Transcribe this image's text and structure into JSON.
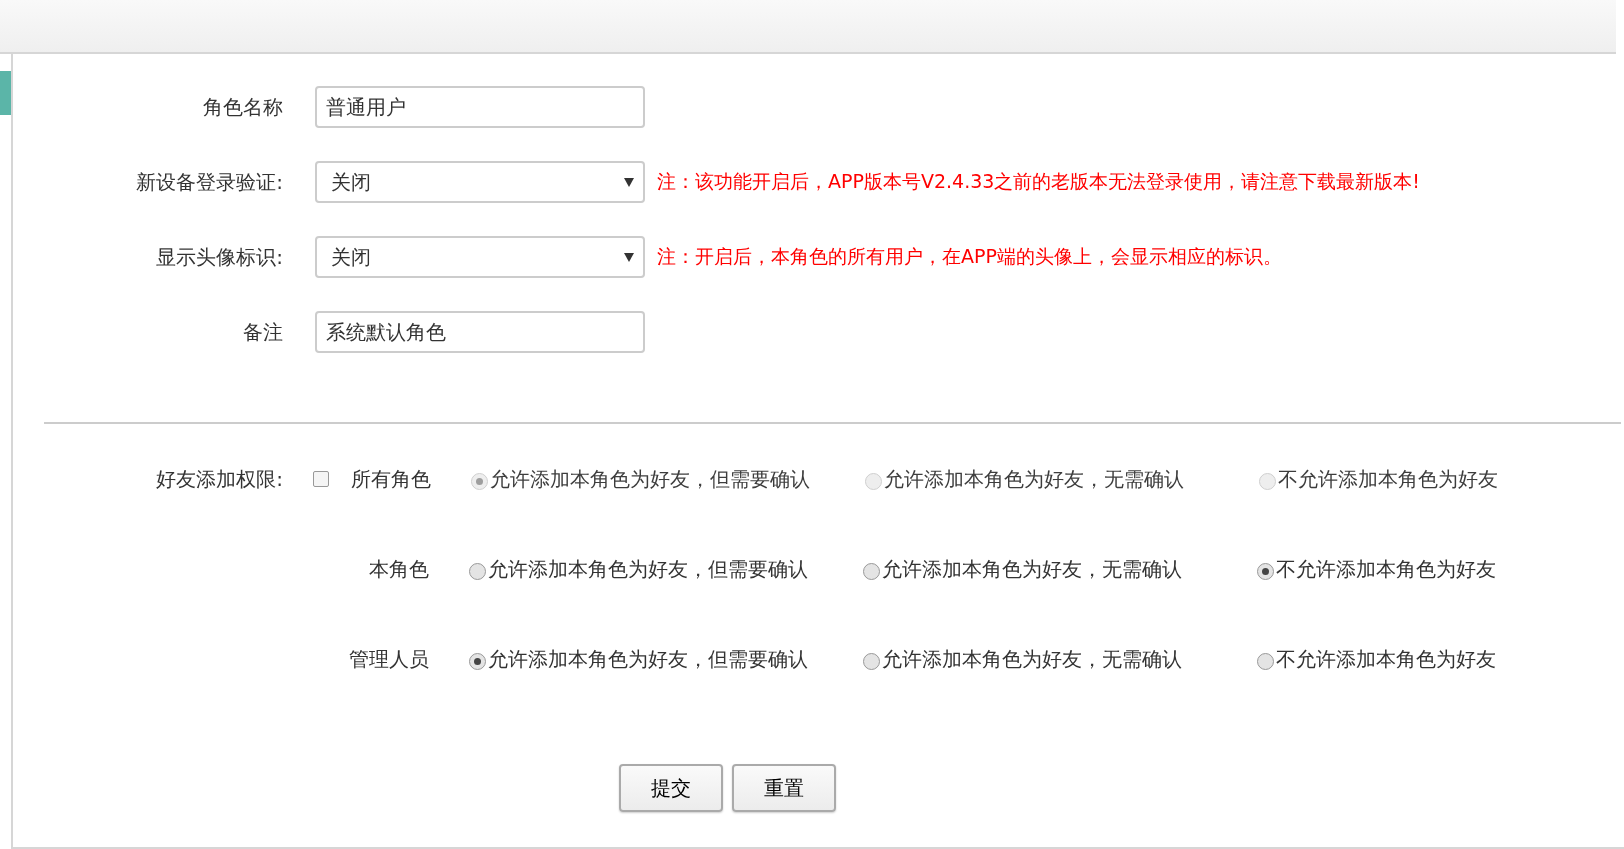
{
  "fields": [
    {
      "kind": "text",
      "label": "角色名称",
      "value": "普通用户"
    },
    {
      "kind": "select",
      "label": "新设备登录验证:",
      "value": "关闭",
      "note": "注：该功能开启后，APP版本号V2.4.33之前的老版本无法登录使用，请注意下载最新版本!"
    },
    {
      "kind": "select",
      "label": "显示头像标识:",
      "value": "关闭",
      "note": "注：开启后，本角色的所有用户，在APP端的头像上，会显示相应的标识。"
    },
    {
      "kind": "text",
      "label": "备注",
      "value": "系统默认角色"
    }
  ],
  "friend_permission": {
    "label": "好友添加权限:",
    "groups": [
      {
        "kind": "checkbox",
        "name": "所有角色",
        "checked": false,
        "disabled": true,
        "options": [
          {
            "label": "允许添加本角色为好友，但需要确认",
            "selected": true
          },
          {
            "label": "允许添加本角色为好友，无需确认",
            "selected": false
          },
          {
            "label": "不允许添加本角色为好友",
            "selected": false
          }
        ]
      },
      {
        "kind": "plain",
        "name": "本角色",
        "disabled": false,
        "options": [
          {
            "label": "允许添加本角色为好友，但需要确认",
            "selected": false
          },
          {
            "label": "允许添加本角色为好友，无需确认",
            "selected": false
          },
          {
            "label": "不允许添加本角色为好友",
            "selected": true
          }
        ]
      },
      {
        "kind": "plain",
        "name": "管理人员",
        "disabled": false,
        "options": [
          {
            "label": "允许添加本角色为好友，但需要确认",
            "selected": true
          },
          {
            "label": "允许添加本角色为好友，无需确认",
            "selected": false
          },
          {
            "label": "不允许添加本角色为好友",
            "selected": false
          }
        ]
      }
    ]
  },
  "buttons": [
    "提交",
    "重置"
  ]
}
